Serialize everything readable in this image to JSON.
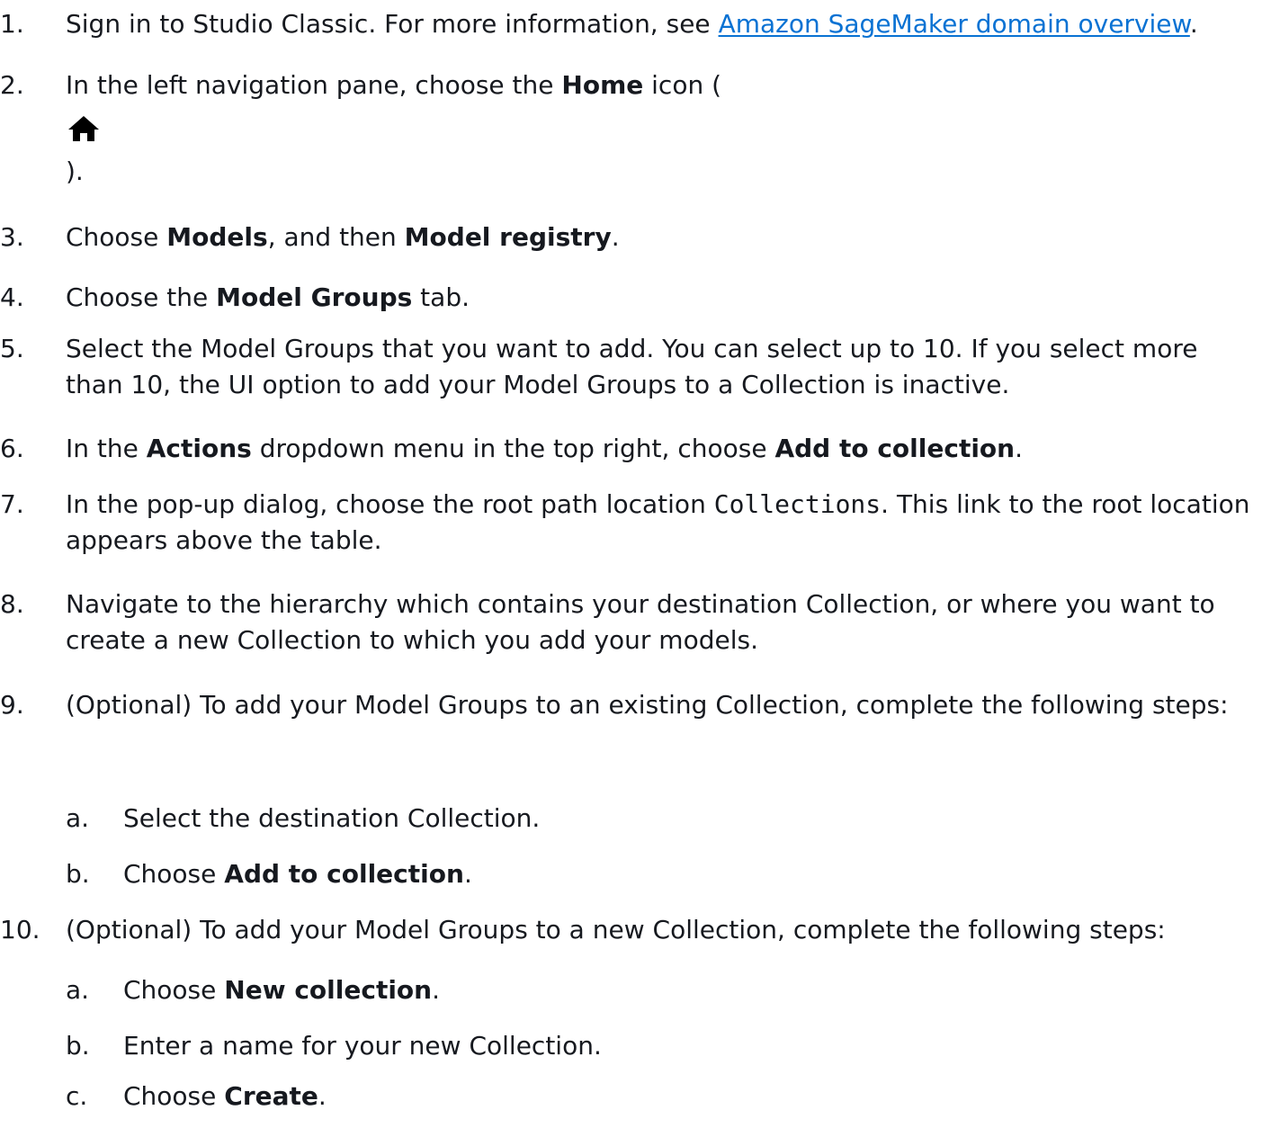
{
  "steps": [
    {
      "number": "1.",
      "before_link": "Sign in to Studio Classic. For more information, see ",
      "link_text": "Amazon SageMaker domain overview",
      "after_link": "."
    },
    {
      "number": "2.",
      "before": "In the left navigation pane, choose the ",
      "bold": "Home",
      "after": " icon (",
      "icon": "home-icon",
      "close": ")."
    },
    {
      "number": "3.",
      "t1": "Choose ",
      "b1": "Models",
      "t2": ", and then ",
      "b2": "Model registry",
      "t3": "."
    },
    {
      "number": "4.",
      "t1": "Choose the ",
      "b1": "Model Groups",
      "t2": " tab."
    },
    {
      "number": "5.",
      "text": "Select the Model Groups that you want to add. You can select up to 10. If you select more than 10, the UI option to add your Model Groups to a Collection is inactive."
    },
    {
      "number": "6.",
      "t1": "In the ",
      "b1": "Actions",
      "t2": " dropdown menu in the top right, choose ",
      "b2": "Add to collection",
      "t3": "."
    },
    {
      "number": "7.",
      "t1": "In the pop-up dialog, choose the root path location ",
      "code": "Collections",
      "t2": ". This link to the root location appears above the table."
    },
    {
      "number": "8.",
      "text": "Navigate to the hierarchy which contains your destination Collection, or where you want to create a new Collection to which you add your models."
    },
    {
      "number": "9.",
      "text": "(Optional) To add your Model Groups to an existing Collection, complete the following steps:",
      "substeps": [
        {
          "letter": "a.",
          "text": "Select the destination Collection."
        },
        {
          "letter": "b.",
          "t1": "Choose ",
          "b1": "Add to collection",
          "t2": "."
        }
      ]
    },
    {
      "number": "10.",
      "text": "(Optional) To add your Model Groups to a new Collection, complete the following steps:",
      "substeps": [
        {
          "letter": "a.",
          "t1": "Choose ",
          "b1": "New collection",
          "t2": "."
        },
        {
          "letter": "b.",
          "text": "Enter a name for your new Collection."
        },
        {
          "letter": "c.",
          "t1": "Choose ",
          "b1": "Create",
          "t2": "."
        }
      ]
    }
  ]
}
